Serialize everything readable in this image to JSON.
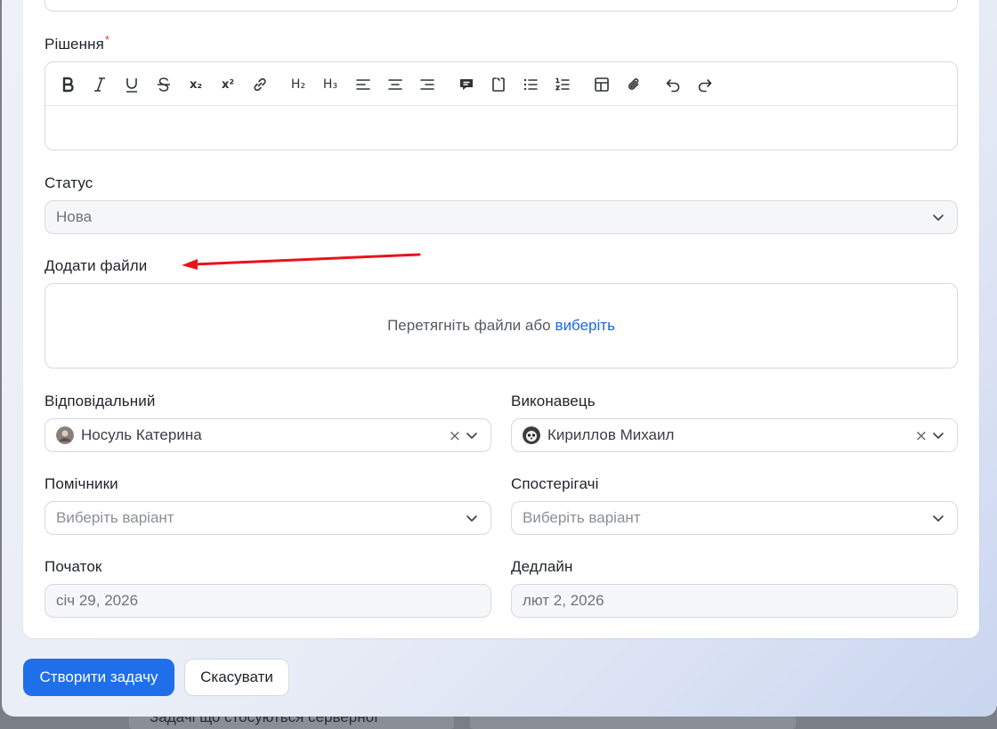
{
  "form": {
    "solution": {
      "label": "Рішення",
      "required_mark": "*"
    },
    "status": {
      "label": "Статус",
      "value": "Нова"
    },
    "files": {
      "label": "Додати файли",
      "drop_text": "Перетягніть файли або",
      "choose_link": "виберіть"
    },
    "responsible": {
      "label": "Відповідальний",
      "value": "Носуль Катерина",
      "clear": "×"
    },
    "executor": {
      "label": "Виконавець",
      "value": "Кириллов Михаил",
      "clear": "×"
    },
    "assistants": {
      "label": "Помічники",
      "placeholder": "Виберіть варіант"
    },
    "observers": {
      "label": "Спостерігачі",
      "placeholder": "Виберіть варіант"
    },
    "start": {
      "label": "Початок",
      "value": "січ 29, 2026"
    },
    "deadline": {
      "label": "Дедлайн",
      "value": "лют 2, 2026"
    }
  },
  "toolbar": {
    "items": [
      "bold-icon",
      "italic-icon",
      "underline-icon",
      "strikethrough-icon",
      "subscript-icon",
      "superscript-icon",
      "link-icon",
      "heading2-icon",
      "heading3-icon",
      "align-left-icon",
      "align-center-icon",
      "align-right-icon",
      "comment-icon",
      "code-block-icon",
      "bullet-list-icon",
      "numbered-list-icon",
      "table-icon",
      "attachment-icon",
      "undo-icon",
      "redo-icon"
    ],
    "sub": "x₂",
    "sup": "x²",
    "h2": "H₂",
    "h3": "H₃"
  },
  "actions": {
    "create": "Створити задачу",
    "cancel": "Скасувати"
  },
  "background": {
    "text": "Задачі що стосуються серверної"
  },
  "colors": {
    "primary": "#1f6feb",
    "link": "#1a66e8",
    "required": "#e53935",
    "annotation_arrow": "#e8141c"
  }
}
